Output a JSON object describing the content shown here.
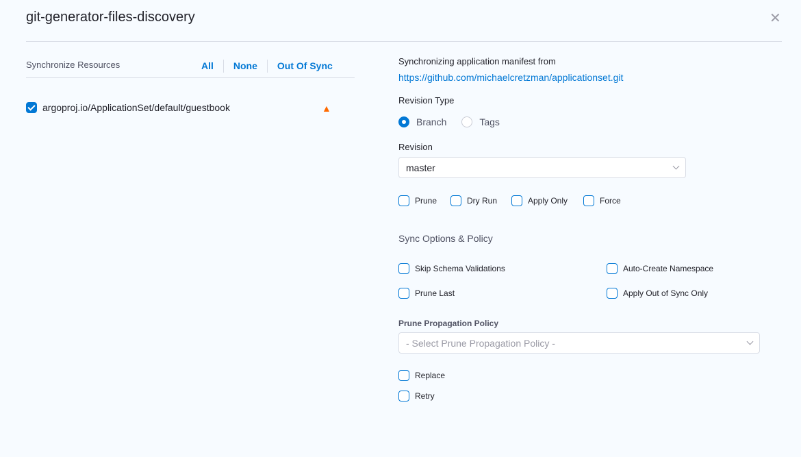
{
  "dialog": {
    "title": "git-generator-files-discovery",
    "close_icon": "close-icon"
  },
  "resources": {
    "label": "Synchronize Resources",
    "filters": [
      "All",
      "None",
      "Out Of Sync"
    ],
    "items": [
      {
        "name": "argoproj.io/ApplicationSet/default/guestbook",
        "checked": true,
        "status_icon": "warning-icon"
      }
    ]
  },
  "source": {
    "label": "Synchronizing application manifest from",
    "url": "https://github.com/michaelcretzman/applicationset.git",
    "revision_type_label": "Revision Type",
    "revision_types": [
      {
        "label": "Branch",
        "selected": true
      },
      {
        "label": "Tags",
        "selected": false
      }
    ],
    "revision_label": "Revision",
    "revision_value": "master"
  },
  "options": [
    {
      "label": "Prune",
      "checked": false
    },
    {
      "label": "Dry Run",
      "checked": false
    },
    {
      "label": "Apply Only",
      "checked": false
    },
    {
      "label": "Force",
      "checked": false
    }
  ],
  "sync_options": {
    "title": "Sync Options & Policy",
    "items": [
      {
        "label": "Skip Schema Validations"
      },
      {
        "label": "Auto-Create Namespace"
      },
      {
        "label": "Prune Last"
      },
      {
        "label": "Apply Out of Sync Only"
      }
    ],
    "prune_policy_label": "Prune Propagation Policy",
    "prune_policy_placeholder": "- Select Prune Propagation Policy -",
    "extra": [
      {
        "label": "Replace"
      },
      {
        "label": "Retry"
      }
    ]
  },
  "colors": {
    "accent": "#0278d5",
    "warning": "#ff6a00"
  }
}
